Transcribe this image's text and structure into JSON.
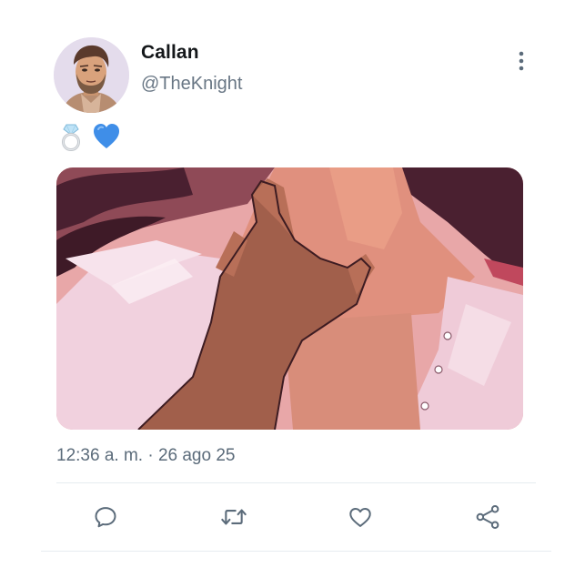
{
  "tweet": {
    "display_name": "Callan",
    "handle": "@TheKnight",
    "text_emojis": [
      "ring-emoji",
      "blue-heart-emoji"
    ],
    "time": "12:36 a. m.",
    "separator": " · ",
    "date": "26 ago 25"
  },
  "actions": {
    "reply_icon": "speech-bubble-icon",
    "retweet_icon": "retweet-icon",
    "like_icon": "heart-icon",
    "share_icon": "share-icon"
  },
  "colors": {
    "icon": "#5b6b7a",
    "heart_emoji": "#3f8ee8",
    "divider": "#e6ecf0"
  }
}
